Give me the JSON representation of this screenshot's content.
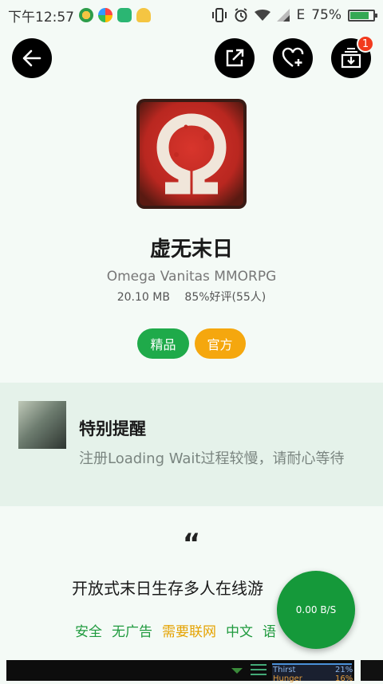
{
  "status_bar": {
    "time": "下午12:57",
    "network": "E",
    "battery_percent": "75%",
    "battery_level": 0.75
  },
  "header": {
    "badge_count": "1"
  },
  "app": {
    "name": "虚无末日",
    "subtitle": "Omega Vanitas MMORPG",
    "size": "20.10 MB",
    "rating": "85%好评(55人)",
    "tags": [
      {
        "label": "精品",
        "color": "#1faa4a"
      },
      {
        "label": "官方",
        "color": "#f5a70e"
      }
    ]
  },
  "notice": {
    "title": "特别提醒",
    "body": "注册Loading Wait过程较慢，请耐心等待"
  },
  "description": {
    "quote_mark": "“",
    "text": "开放式末日生存多人在线游"
  },
  "features": [
    {
      "label": "安全",
      "color": "#1f9a3e"
    },
    {
      "label": "无广告",
      "color": "#1f9a3e"
    },
    {
      "label": "需要联网",
      "color": "#e5a200"
    },
    {
      "label": "中文",
      "color": "#1f9a3e"
    },
    {
      "label": "语",
      "color": "#1f9a3e"
    }
  ],
  "speed_fab": {
    "text": "0.00 B/S"
  },
  "screenshot_preview": {
    "stat_1": "Thirst",
    "stat_1_value": "21%",
    "stat_2": "Hunger",
    "stat_2_value": "16%"
  }
}
